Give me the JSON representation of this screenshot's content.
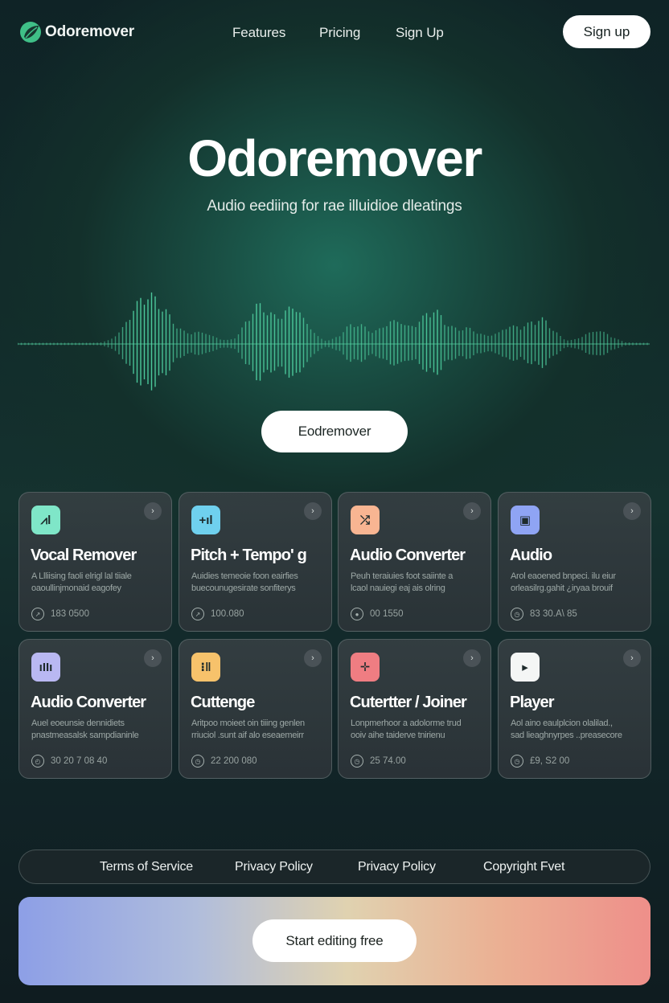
{
  "brand": {
    "name": "Odoremover",
    "logo_icon": "leaf-logo-icon"
  },
  "nav": {
    "links": [
      "Features",
      "Pricing",
      "Sign Up"
    ],
    "signup_button": "Sign up"
  },
  "hero": {
    "title": "Odoremover",
    "subtitle": "Audio eediing for rae illuidioe dleatings",
    "cta_label": "Eodremover"
  },
  "cards": [
    {
      "title": "Vocal Remover",
      "desc_line1": "A Llliising faoli elrigl lal tiiale",
      "desc_line2": "oaoullinjmonaid eagofey",
      "meta": "183 0500",
      "icon": "waveform-icon",
      "icon_glyph": "⩘l",
      "icon_color": "#7fe6c8"
    },
    {
      "title": "Pitch + Tempo' g",
      "desc_line1": "Auidies temeoie foon eairfies",
      "desc_line2": "buecounugesirate sonfiterys",
      "meta": "100.080",
      "icon": "sliders-icon",
      "icon_glyph": "+ıl",
      "icon_color": "#6fd0ee"
    },
    {
      "title": "Audio Converter",
      "desc_line1": "Peuh teraiuies foot saiinte a",
      "desc_line2": "lcaol nauiegi eaj ais olring",
      "meta": "00 1550",
      "icon": "convert-icon",
      "icon_glyph": "⤮",
      "icon_color": "#f8b592"
    },
    {
      "title": "Audio",
      "desc_line1": "Arol eaoened bnpeci. ilu eiur",
      "desc_line2": "orleasilrg.gahit ¿iryaa brouif",
      "meta": "83 30.A\\ 85",
      "icon": "square-icon",
      "icon_glyph": "▣",
      "icon_color": "#8fa4f4"
    },
    {
      "title": "Audio Converter",
      "desc_line1": "Auel eoeunsie dennidiets",
      "desc_line2": "pnastmeasalsk sampdianinle",
      "meta": "30 20 7 08 40",
      "icon": "equalizer-icon",
      "icon_glyph": "ıIIı",
      "icon_color": "#b9b8f2"
    },
    {
      "title": "Cuttenge",
      "desc_line1": "Aritpoo moieet oin tiiing genlen",
      "desc_line2": "rriuciol .sunt aif alo eseaemeirr",
      "meta": "22 200 080",
      "icon": "cut-icon",
      "icon_glyph": "⁝‖",
      "icon_color": "#f7c26b"
    },
    {
      "title": "Cutertter / Joiner",
      "desc_line1": "Lonpmerhoor a adolorme trud",
      "desc_line2": "ooiv aihe taiderve tnirienu",
      "meta": "25 74.00",
      "icon": "scissors-icon",
      "icon_glyph": "✛",
      "icon_color": "#ef7d82"
    },
    {
      "title": "Player",
      "desc_line1": "Aol aino eaulplcion olalilad.,",
      "desc_line2": "sad lieaghnyrpes ..preasecore",
      "meta": "£9, S2 00",
      "icon": "play-icon",
      "icon_glyph": "▸",
      "icon_color": "#f4f6f5"
    }
  ],
  "footer": {
    "links": [
      "Terms of Service",
      "Privacy Policy",
      "Privacy Policy",
      "Copyright Fvet"
    ]
  },
  "cta_banner": {
    "button": "Start editing free"
  }
}
